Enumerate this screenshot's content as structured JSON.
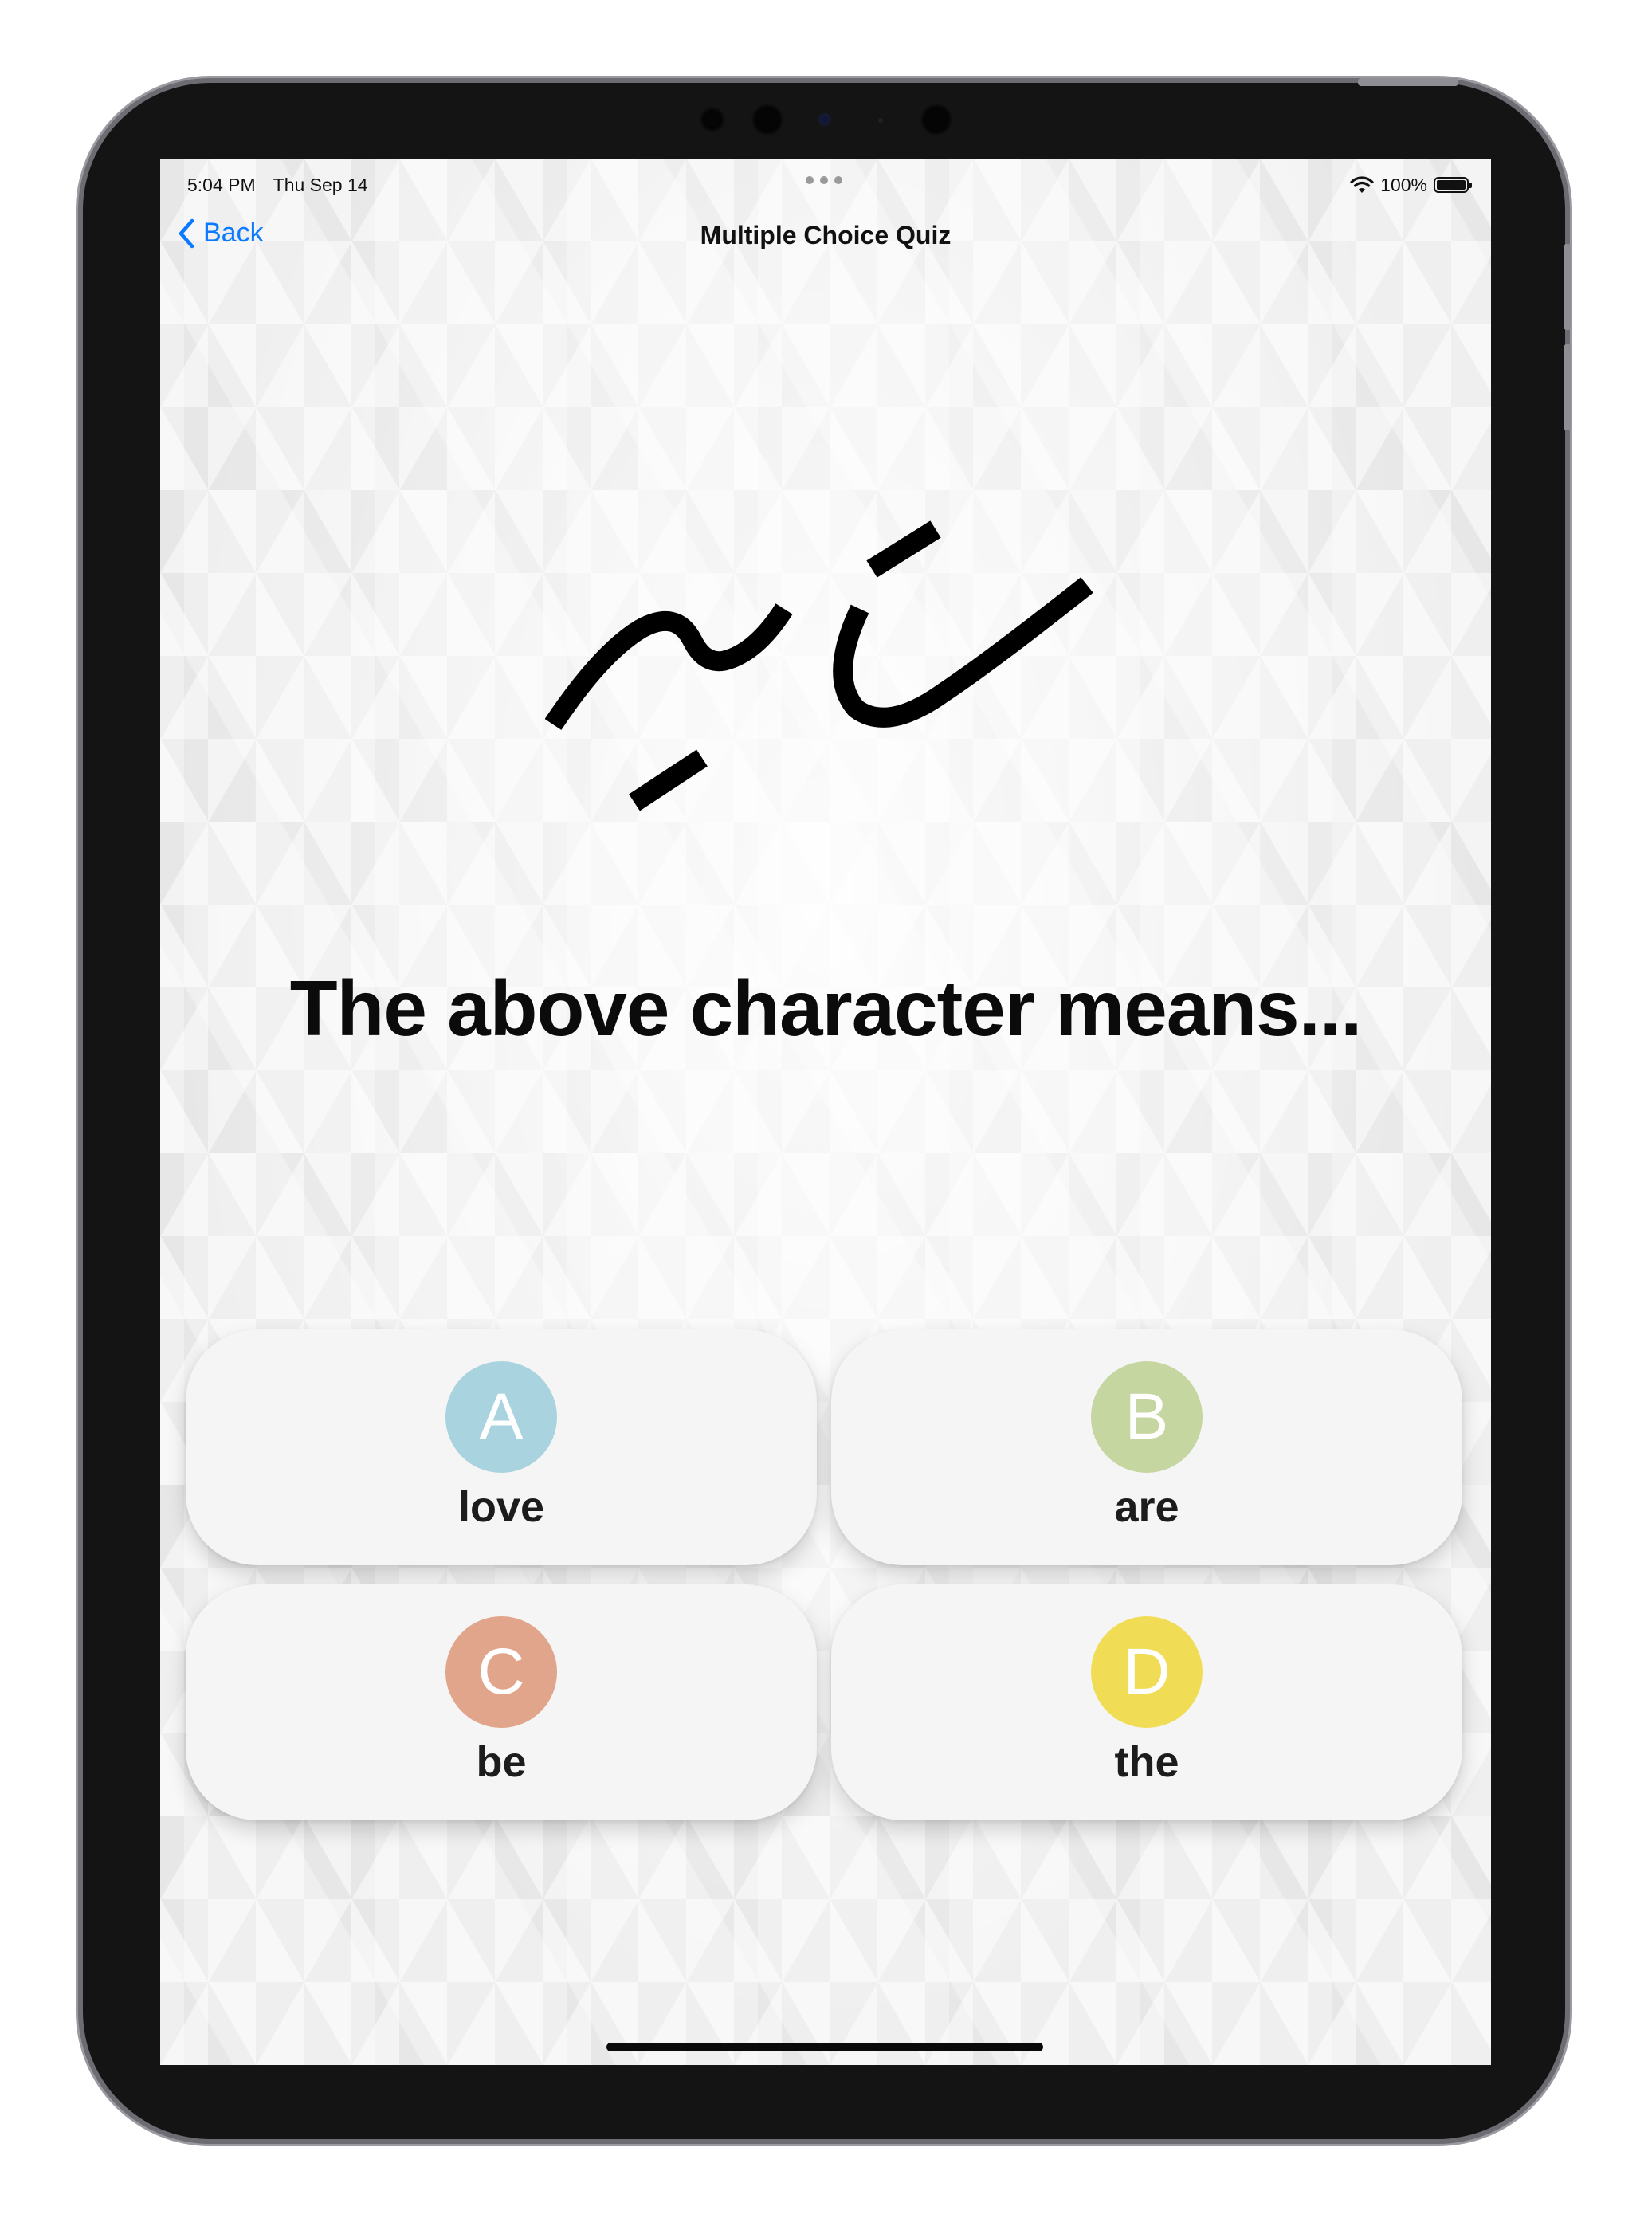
{
  "status_bar": {
    "time": "5:04 PM",
    "date": "Thu Sep 14",
    "battery": "100%"
  },
  "nav": {
    "back_label": "Back",
    "title": "Multiple Choice Quiz"
  },
  "question": {
    "text": "The above character means..."
  },
  "answers": [
    {
      "letter": "A",
      "text": "love",
      "color": "#a9d3df"
    },
    {
      "letter": "B",
      "text": "are",
      "color": "#c5d6a0"
    },
    {
      "letter": "C",
      "text": "be",
      "color": "#e1a58b"
    },
    {
      "letter": "D",
      "text": "the",
      "color": "#f1dd55"
    }
  ]
}
